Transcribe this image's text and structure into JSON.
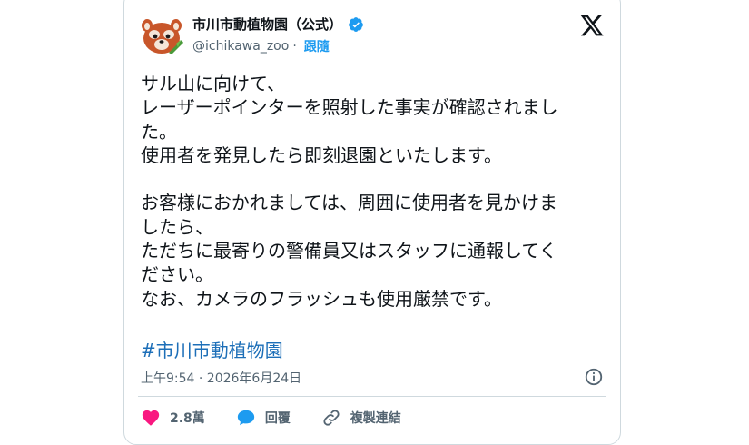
{
  "account": {
    "display_name": "市川市動植物園（公式）",
    "handle": "@ichikawa_zoo",
    "separator": "·",
    "follow_label": "跟隨"
  },
  "tweet": {
    "text": "サル山に向けて、\nレーザーポインターを照射した事実が確認されまし\nた。\n使用者を発見したら即刻退園といたします。\n\nお客様におかれましては、周囲に使用者を見かけま\nしたら、\nただちに最寄りの警備員又はスタッフに通報してく\nださい。\nなお、カメラのフラッシュも使用厳禁です。",
    "hashtag": "#市川市動植物園",
    "timestamp": "上午9:54 · 2026年6月24日"
  },
  "actions": {
    "like_count": "2.8萬",
    "reply_label": "回覆",
    "copy_link_label": "複製連結"
  },
  "colors": {
    "link": "#1d6fb8",
    "verified": "#1d9bf0",
    "like_heart": "#f91880",
    "reply_bubble": "#1d9bf0",
    "muted": "#536471",
    "border": "#cfd9de"
  },
  "icons": [
    "red-panda-avatar",
    "verified-badge-icon",
    "x-logo-icon",
    "info-icon",
    "heart-icon",
    "reply-bubble-icon",
    "link-icon"
  ]
}
